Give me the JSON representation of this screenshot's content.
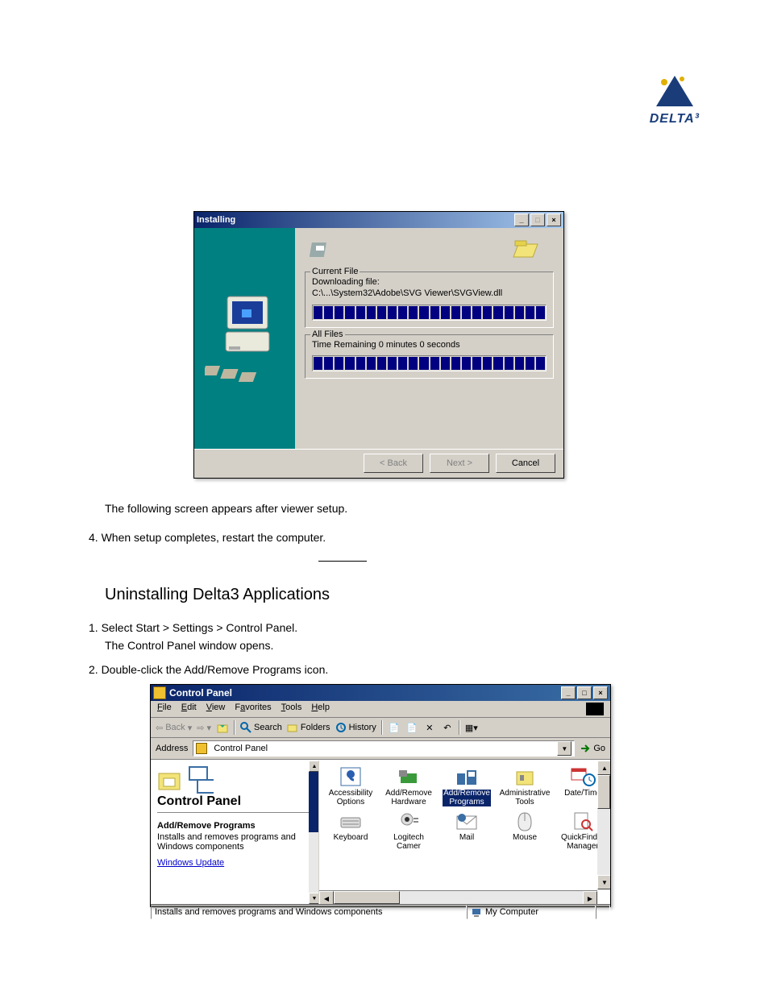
{
  "logo": {
    "brand": "DELTA³"
  },
  "doc": {
    "line_below_figure": "The following screen appears after viewer setup.",
    "numbered": "4.  When setup completes, restart the computer.",
    "section_title": "Uninstalling Delta3 Applications",
    "step1a": "1.  Select Start > Settings > Control Panel.",
    "step1b": "The Control Panel window opens.",
    "step2": "2.  Double-click the Add/Remove Programs icon."
  },
  "installer": {
    "title": "Installing",
    "current_file": {
      "legend": "Current File",
      "label": "Downloading file:",
      "path": "C:\\...\\System32\\Adobe\\SVG Viewer\\SVGView.dll"
    },
    "all_files": {
      "legend": "All Files",
      "time_label": "Time Remaining 0 minutes 0 seconds"
    },
    "buttons": {
      "back": "< Back",
      "next": "Next >",
      "cancel": "Cancel"
    },
    "win_controls": {
      "min": "_",
      "max": "□",
      "close": "×"
    },
    "progress_segments": 22
  },
  "cpanel": {
    "title": "Control Panel",
    "win_controls": {
      "min": "_",
      "max": "□",
      "close": "×"
    },
    "menu": {
      "file": "File",
      "edit": "Edit",
      "view": "View",
      "favorites": "Favorites",
      "tools": "Tools",
      "help": "Help"
    },
    "toolbar": {
      "back": "Back",
      "search": "Search",
      "folders": "Folders",
      "history": "History"
    },
    "address": {
      "label": "Address",
      "value": "Control Panel",
      "go": "Go"
    },
    "left": {
      "title": "Control Panel",
      "heading": "Add/Remove Programs",
      "desc": "Installs and removes programs and Windows components",
      "link": "Windows Update"
    },
    "items_row1": [
      {
        "name": "Accessibility Options"
      },
      {
        "name": "Add/Remove Hardware"
      },
      {
        "name": "Add/Remove Programs",
        "selected": true
      },
      {
        "name": "Administrative Tools"
      },
      {
        "name": "Date/Time"
      }
    ],
    "items_row2": [
      {
        "name": "Keyboard"
      },
      {
        "name": "Logitech Camer"
      },
      {
        "name": "Mail"
      },
      {
        "name": "Mouse"
      },
      {
        "name": "QuickFinder Manager"
      }
    ],
    "status": {
      "left": "Installs and removes programs and Windows components",
      "right": "My Computer"
    }
  }
}
